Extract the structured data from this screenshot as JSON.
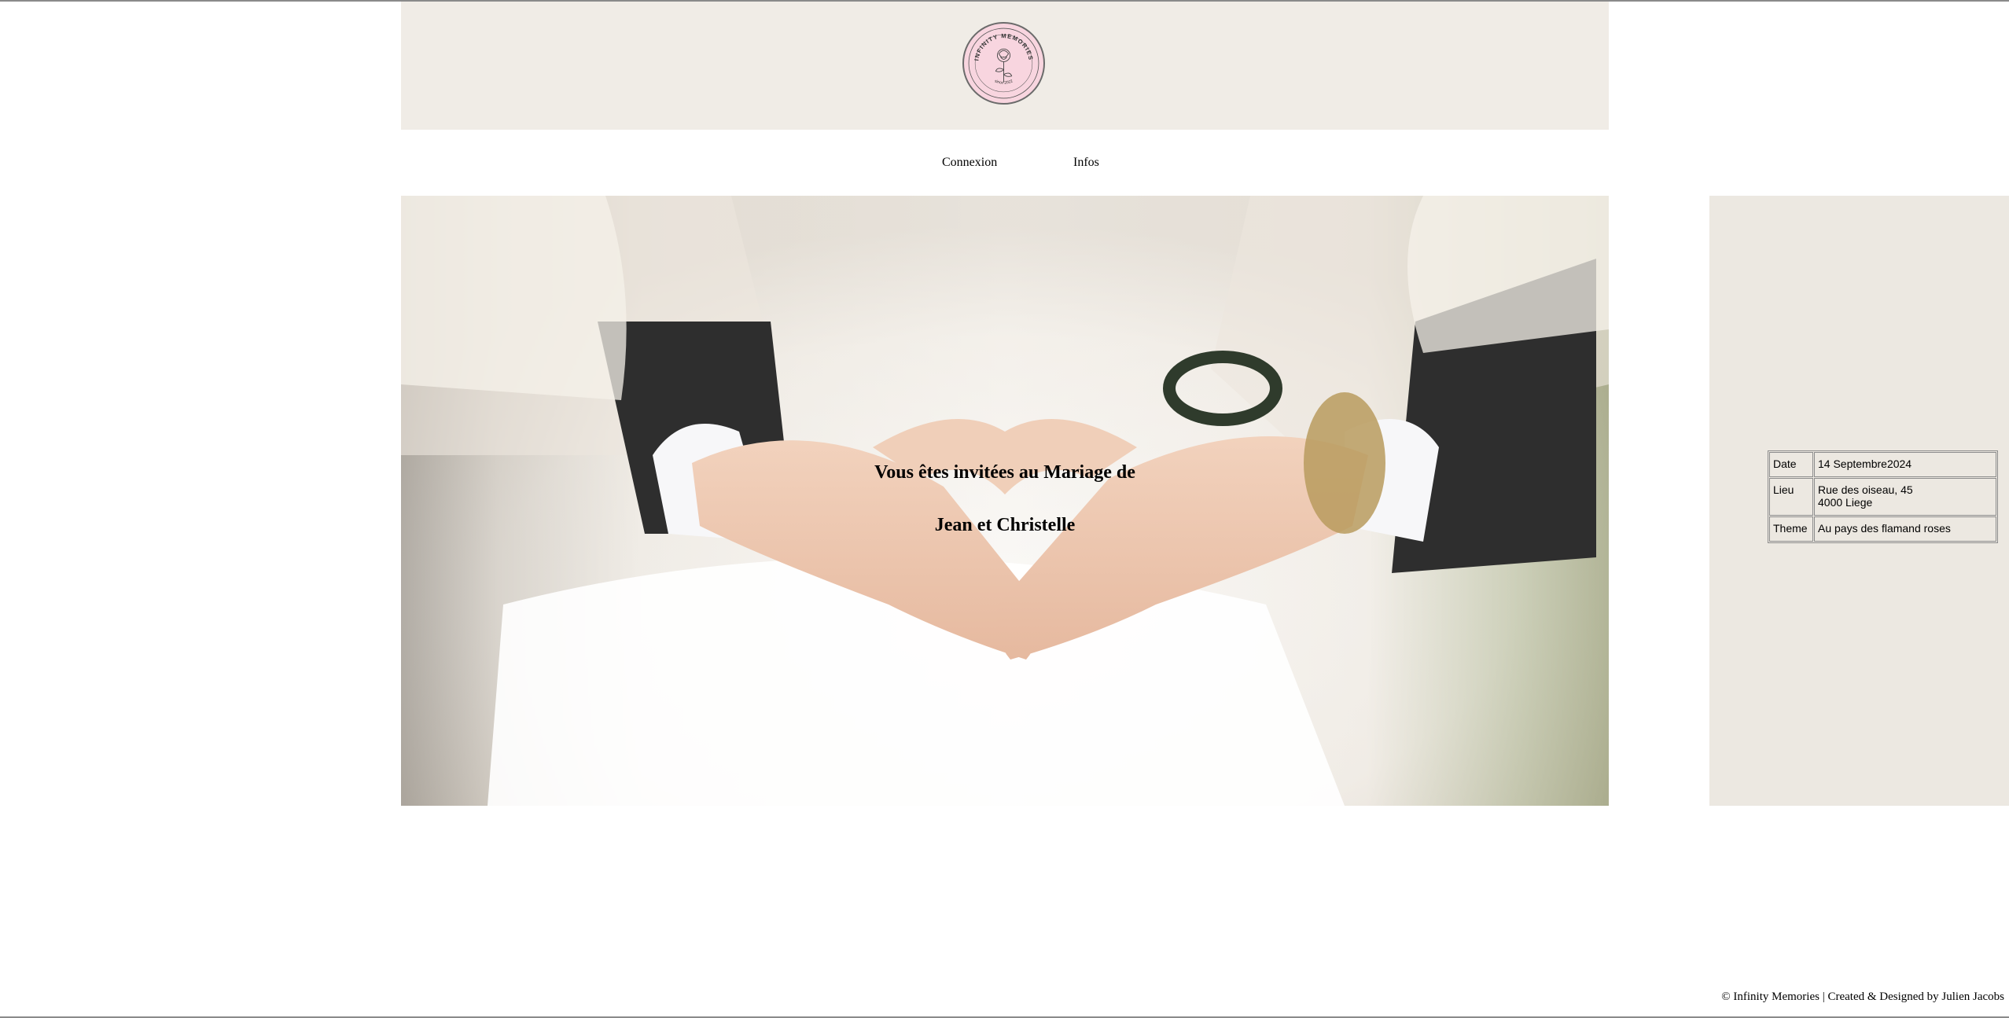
{
  "brand": {
    "logo_text_top": "INFINITY MEMORIES",
    "logo_text_bottom": "since 2022",
    "logo_icon": "rose-icon"
  },
  "nav": {
    "items": [
      {
        "label": "Connexion"
      },
      {
        "label": "Infos"
      }
    ]
  },
  "hero": {
    "line1": "Vous êtes invitées au Mariage de",
    "line2": "Jean et Christelle"
  },
  "details": {
    "rows": [
      {
        "key": "Date",
        "value": "14 Septembre2024"
      },
      {
        "key": "Lieu",
        "value": "Rue des oiseau, 45",
        "value2": "4000 Liege"
      },
      {
        "key": "Theme",
        "value": "Au pays des flamand roses"
      }
    ]
  },
  "footer": {
    "text": "© Infinity Memories | Created & Designed by Julien Jacobs"
  },
  "colors": {
    "header_band": "#f0ece6",
    "side_panel": "#ece8e1",
    "logo_bg": "#f8d5df"
  }
}
